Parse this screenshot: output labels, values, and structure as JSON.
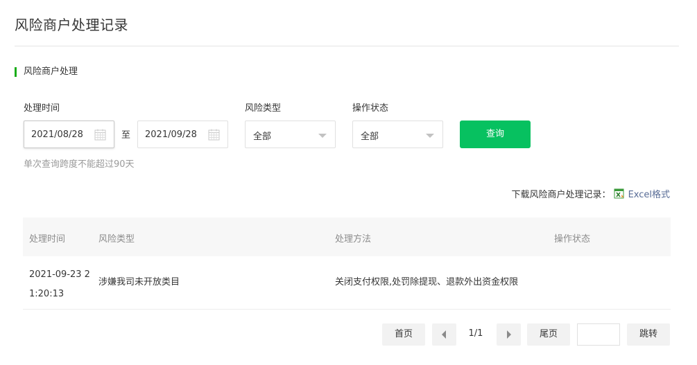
{
  "header": {
    "title": "风险商户处理记录"
  },
  "section": {
    "title": "风险商户处理"
  },
  "filters": {
    "time_label": "处理时间",
    "start_date": "2021/08/28",
    "range_separator": "至",
    "end_date": "2021/09/28",
    "risk_type_label": "风险类型",
    "risk_type_value": "全部",
    "status_label": "操作状态",
    "status_value": "全部",
    "query_button": "查询",
    "hint": "单次查询跨度不能超过90天"
  },
  "download": {
    "label": "下载风险商户处理记录：",
    "link": "Excel格式",
    "icon": "excel-icon"
  },
  "table": {
    "columns": [
      "处理时间",
      "风险类型",
      "处理方法",
      "操作状态"
    ],
    "rows": [
      {
        "time_line1": "2021-09-23 2",
        "time_line2": "1:20:13",
        "risk_type": "涉嫌我司未开放类目",
        "method": "关闭支付权限,处罚除提现、退款外出资金权限",
        "status": ""
      }
    ]
  },
  "pagination": {
    "first": "首页",
    "page": "1/1",
    "last": "尾页",
    "jump_value": "",
    "jump": "跳转"
  },
  "colors": {
    "primary_green": "#07c160",
    "section_bar": "#1aad19",
    "link": "#576b95"
  }
}
